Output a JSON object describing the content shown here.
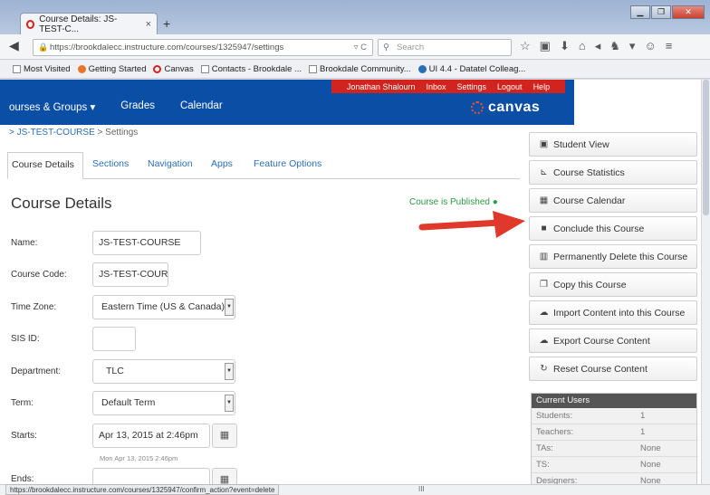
{
  "browser": {
    "tab_title": "Course Details: JS-TEST-C...",
    "tab_close": "×",
    "new_tab": "+",
    "window_buttons": [
      "▁",
      "❐",
      "✕"
    ],
    "url": "https://brookdalecc.instructure.com/courses/1325947/settings",
    "url_controls": "▿ C",
    "search_placeholder": "Search",
    "toolbar_icons": [
      "☆",
      "▣",
      "⬇",
      "⌂",
      "◂",
      "♞",
      "▾",
      "☺",
      "≡"
    ],
    "bookmarks": [
      "Most Visited",
      "Getting Started",
      "Canvas",
      "Contacts - Brookdale ...",
      "Brookdale Community...",
      "UI 4.4 - Datatel Colleag..."
    ],
    "status_url": "https://brookdalecc.instructure.com/courses/1325947/confirm_action?event=delete",
    "status_mid": "III"
  },
  "header": {
    "user_nav": [
      "Jonathan Shalourn",
      "Inbox",
      "Settings",
      "Logout",
      "Help"
    ],
    "main_nav": [
      "ourses & Groups ▾",
      "Grades",
      "Calendar"
    ],
    "logo": "canvas"
  },
  "breadcrumb": {
    "course": "JS-TEST-COURSE",
    "current": "Settings",
    "sep": ">"
  },
  "tabs": [
    "Course Details",
    "Sections",
    "Navigation",
    "Apps",
    "Feature Options"
  ],
  "content": {
    "title": "Course Details",
    "published": "Course is Published",
    "fields": [
      {
        "label": "Name:",
        "value": "JS-TEST-COURSE"
      },
      {
        "label": "Course Code:",
        "value": "JS-TEST-COUR"
      },
      {
        "label": "Time Zone:",
        "value": "Eastern Time (US & Canada)"
      },
      {
        "label": "SIS ID:",
        "value": ""
      },
      {
        "label": "Department:",
        "value": "TLC"
      },
      {
        "label": "Term:",
        "value": "Default Term"
      },
      {
        "label": "Starts:",
        "value": "Apr 13, 2015 at  2:46pm"
      },
      {
        "label": "Ends:",
        "value": ""
      }
    ],
    "starts_hint": "Mon Apr 13, 2015 2:46pm"
  },
  "sidebar": {
    "buttons": [
      {
        "label": "Student View",
        "icon": "▣"
      },
      {
        "label": "Course Statistics",
        "icon": "⊾"
      },
      {
        "label": "Course Calendar",
        "icon": "▦"
      },
      {
        "label": "Conclude this Course",
        "icon": "■"
      },
      {
        "label": "Permanently Delete this Course",
        "icon": "▥"
      },
      {
        "label": "Copy this Course",
        "icon": "❐"
      },
      {
        "label": "Import Content into this Course",
        "icon": "☁"
      },
      {
        "label": "Export Course Content",
        "icon": "☁"
      },
      {
        "label": "Reset Course Content",
        "icon": "↻"
      }
    ]
  },
  "current_users": {
    "title": "Current Users",
    "rows": [
      {
        "role": "Students:",
        "count": "1"
      },
      {
        "role": "Teachers:",
        "count": "1"
      },
      {
        "role": "TAs:",
        "count": "None"
      },
      {
        "role": "TS:",
        "count": "None"
      },
      {
        "role": "Designers:",
        "count": "None"
      }
    ]
  },
  "colors": {
    "canvas_blue": "#0a4ea6",
    "canvas_red": "#d2241e",
    "published_green": "#2b9c41",
    "annotation_arrow": "#e0392b"
  }
}
